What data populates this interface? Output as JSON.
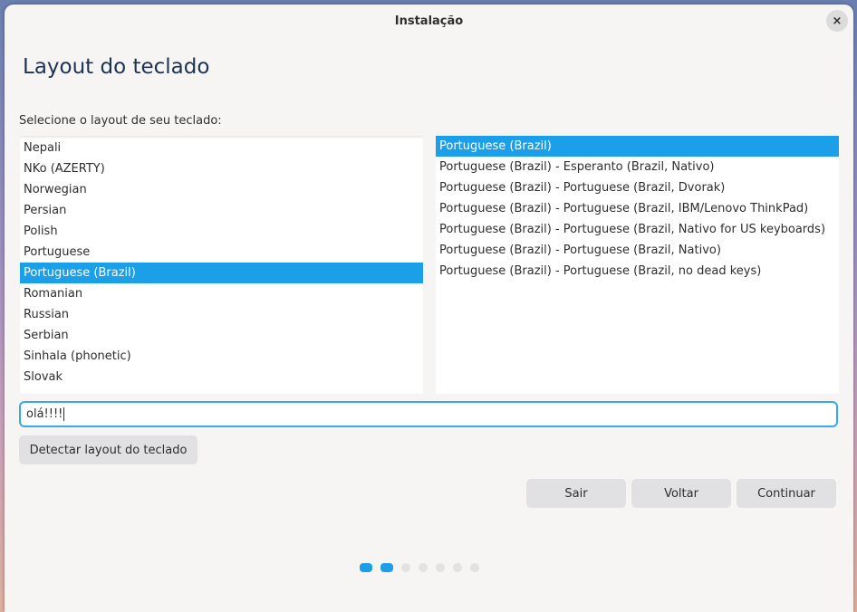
{
  "window": {
    "title": "Instalação",
    "close_icon": "×"
  },
  "page": {
    "title": "Layout do teclado",
    "prompt": "Selecione o layout de seu teclado:"
  },
  "layouts": {
    "items": [
      "Nepali",
      "NKo (AZERTY)",
      "Norwegian",
      "Persian",
      "Polish",
      "Portuguese",
      "Portuguese (Brazil)",
      "Romanian",
      "Russian",
      "Serbian",
      "Sinhala (phonetic)",
      "Slovak"
    ],
    "selected_index": 6
  },
  "variants": {
    "items": [
      "Portuguese (Brazil)",
      "Portuguese (Brazil) - Esperanto (Brazil, Nativo)",
      "Portuguese (Brazil) - Portuguese (Brazil, Dvorak)",
      "Portuguese (Brazil) - Portuguese (Brazil, IBM/Lenovo ThinkPad)",
      "Portuguese (Brazil) - Portuguese (Brazil, Nativo for US keyboards)",
      "Portuguese (Brazil) - Portuguese (Brazil, Nativo)",
      "Portuguese (Brazil) - Portuguese (Brazil, no dead keys)"
    ],
    "selected_index": 0
  },
  "test_input": {
    "value": "olá!!!!"
  },
  "buttons": {
    "detect": "Detectar layout do teclado",
    "quit": "Sair",
    "back": "Voltar",
    "next": "Continuar"
  },
  "progress": {
    "total_steps": 7,
    "current_step": 2
  },
  "colors": {
    "accent": "#1a9fe8",
    "title": "#1e3350"
  }
}
